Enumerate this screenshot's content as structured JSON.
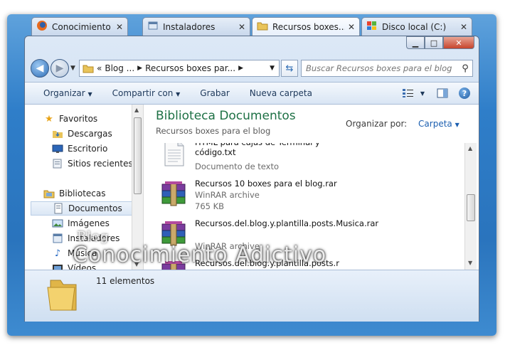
{
  "tabs": [
    {
      "label": "Conocimiento  A...",
      "icon": "firefox-icon"
    },
    {
      "label": "Instaladores",
      "icon": "window-icon"
    },
    {
      "label": "Recursos  boxes...",
      "icon": "folder-icon"
    },
    {
      "label": "Disco local (C:)",
      "icon": "drive-icon"
    }
  ],
  "caption": {
    "minimize": "▁",
    "maximize": "□",
    "close": "✕"
  },
  "address": {
    "prefix": "«",
    "crumbs": [
      "Blog ...",
      "Recursos boxes par..."
    ]
  },
  "search": {
    "placeholder": "Buscar Recursos boxes para el blog"
  },
  "toolbar": {
    "organize": "Organizar",
    "share": "Compartir con",
    "burn": "Grabar",
    "new_folder": "Nueva carpeta",
    "help": "?"
  },
  "sidebar": {
    "favorites": "Favoritos",
    "items_fav": [
      "Descargas",
      "Escritorio",
      "Sitios recientes"
    ],
    "libraries": "Bibliotecas",
    "items_lib": [
      "Documentos",
      "Imágenes",
      "Instaladores",
      "Música",
      "Vídeos"
    ]
  },
  "main": {
    "title": "Biblioteca Documentos",
    "subtitle": "Recursos boxes para el blog",
    "arrange_label": "Organizar por:",
    "arrange_value": "Carpeta"
  },
  "files": [
    {
      "name": "HTML para cajas de Terminal y código.txt",
      "meta1": "Documento de texto",
      "meta2": "",
      "icon": "text-file-icon"
    },
    {
      "name": "Recursos 10 boxes para el blog.rar",
      "meta1": "WinRAR archive",
      "meta2": "765 KB",
      "icon": "winrar-icon"
    },
    {
      "name": "Recursos.del.blog.y.plantilla.posts.Musica.rar",
      "meta1": "WinRAR archive",
      "meta2": "",
      "icon": "winrar-icon"
    },
    {
      "name": "Recursos.del.blog.y.plantilla.posts.r",
      "meta1": "",
      "meta2": "",
      "icon": "winrar-icon"
    }
  ],
  "status": {
    "count": "11 elementos"
  },
  "watermark": {
    "small": "Blog",
    "big": "Conocimiento Adictivo"
  }
}
